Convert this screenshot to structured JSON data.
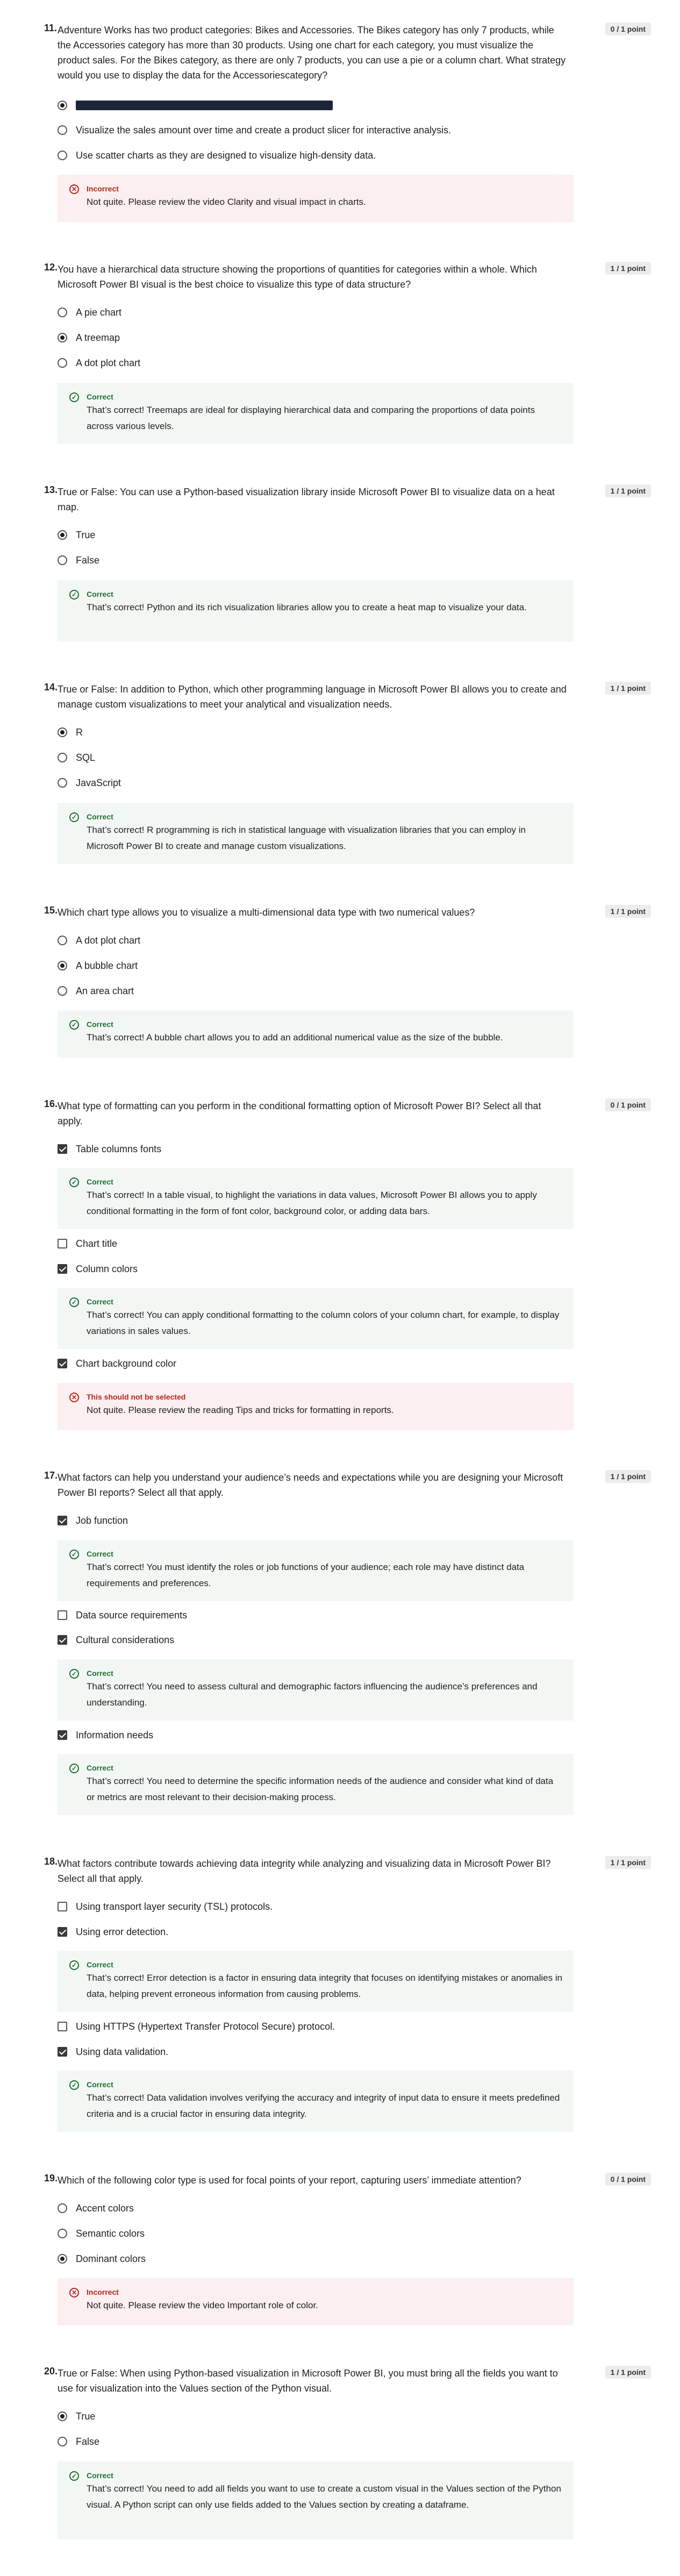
{
  "q11": {
    "num": "11.",
    "text": "Adventure Works has two product categories: Bikes and Accessories. The Bikes category has only 7 products, while the Accessories category has more than 30 products. Using one chart for each category, you must visualize the product sales. For the Bikes category, as there are only 7 products, you can use a pie or a column chart. What strategy would you use to display the data for the Accessoriescategory?",
    "points": "0 / 1 point",
    "options": [
      "",
      "Visualize the sales amount over time and create a product slicer for interactive analysis.",
      "Use scatter charts as they are designed to visualize high-density data."
    ],
    "fb_title": "Incorrect",
    "fb_text": "Not quite. Please review the video Clarity and visual impact in charts."
  },
  "q12": {
    "num": "12.",
    "text": "You have a hierarchical data structure showing the proportions of quantities for categories within a whole. Which Microsoft Power BI visual is the best choice to visualize this type of data structure?",
    "points": "1 / 1 point",
    "options": [
      "A pie chart",
      "A treemap",
      "A dot plot chart"
    ],
    "fb_title": "Correct",
    "fb_text": "That’s correct! Treemaps are ideal for displaying hierarchical data and comparing the proportions of data points across various levels."
  },
  "q13": {
    "num": "13.",
    "text": "True or False: You can use a Python-based visualization library inside Microsoft Power BI to visualize data on a heat map.",
    "points": "1 / 1 point",
    "options": [
      "True",
      "False"
    ],
    "fb_title": "Correct",
    "fb_text": "That’s correct! Python and its rich visualization libraries allow you to create a heat map to visualize your data."
  },
  "q14": {
    "num": "14.",
    "text": "True or False: In addition to Python, which other programming language in Microsoft Power BI allows you to create and manage custom visualizations to meet your analytical and visualization needs.",
    "points": "1 / 1 point",
    "options": [
      "R",
      "SQL",
      "JavaScript"
    ],
    "fb_title": "Correct",
    "fb_text": "That’s correct! R programming is rich in statistical language with visualization libraries that you can employ in Microsoft Power BI to create and manage custom visualizations."
  },
  "q15": {
    "num": "15.",
    "text": "Which chart type allows you to visualize a multi-dimensional data type with two numerical values?",
    "points": "1 / 1 point",
    "options": [
      "A dot plot chart",
      "A bubble chart",
      "An area chart"
    ],
    "fb_title": "Correct",
    "fb_text": "That’s correct! A bubble chart allows you to add an additional numerical value as the size of the bubble."
  },
  "q16": {
    "num": "16.",
    "text": "What type of formatting can you perform in the conditional formatting option of Microsoft Power BI? Select all that apply.",
    "points": "0 / 1 point",
    "options": [
      "Table columns fonts",
      "Chart title",
      "Column colors",
      "Chart background color"
    ],
    "fb1_title": "Correct",
    "fb1_text": "That’s correct! In a table visual, to highlight the variations in data values, Microsoft Power BI allows you to apply conditional formatting in the form of font color, background color, or adding data bars.",
    "fb2_title": "Correct",
    "fb2_text": "That’s correct! You can apply conditional formatting to the column colors of your column chart, for example, to display variations in sales values.",
    "fb3_title": "This should not be selected",
    "fb3_text": "Not quite. Please review the reading Tips and tricks for formatting in reports."
  },
  "q17": {
    "num": "17.",
    "text": "What factors can help you understand your audience’s needs and expectations while you are designing your Microsoft Power BI reports? Select all that apply.",
    "points": "1 / 1 point",
    "options": [
      "Job function",
      "Data source requirements",
      "Cultural considerations",
      "Information needs"
    ],
    "fb1_title": "Correct",
    "fb1_text": "That’s correct! You must identify the roles or job functions of your audience; each role may have distinct data requirements and preferences.",
    "fb2_title": "Correct",
    "fb2_text": "That’s correct! You need to assess cultural and demographic factors influencing the audience’s preferences and understanding.",
    "fb3_title": "Correct",
    "fb3_text": "That’s correct! You need to determine the specific information needs of the audience and consider what kind of data or metrics are most relevant to their decision-making process."
  },
  "q18": {
    "num": "18.",
    "text": "What factors contribute towards achieving data integrity while analyzing and visualizing data in Microsoft Power BI? Select all that apply.",
    "points": "1 / 1 point",
    "options": [
      "Using transport layer security (TSL) protocols.",
      "Using error detection.",
      "Using HTTPS (Hypertext Transfer Protocol Secure) protocol.",
      "Using data validation."
    ],
    "fb1_title": "Correct",
    "fb1_text": "That’s correct! Error detection is a factor in ensuring data integrity that focuses on identifying mistakes or anomalies in data, helping prevent erroneous information from causing problems.",
    "fb2_title": "Correct",
    "fb2_text": "That’s correct! Data validation involves verifying the accuracy and integrity of input data to ensure it meets predefined criteria and is a crucial factor in ensuring data integrity."
  },
  "q19": {
    "num": "19.",
    "text": "Which of the following color type is used for focal points of your report, capturing users’ immediate attention?",
    "points": "0 / 1 point",
    "options": [
      "Accent colors",
      "Semantic colors",
      "Dominant colors"
    ],
    "fb_title": "Incorrect",
    "fb_text": "Not quite. Please review the video Important role of color."
  },
  "q20": {
    "num": "20.",
    "text": "True or False: When using Python-based visualization in Microsoft Power BI, you must bring all the fields you want to use for visualization into the Values section of the Python visual.",
    "points": "1 / 1 point",
    "options": [
      "True",
      "False"
    ],
    "fb_title": "Correct",
    "fb_text": "That’s correct! You need to add all fields you want to use to create a custom visual in the Values section of the Python visual. A Python script can only use fields added to the Values section by creating a dataframe."
  }
}
